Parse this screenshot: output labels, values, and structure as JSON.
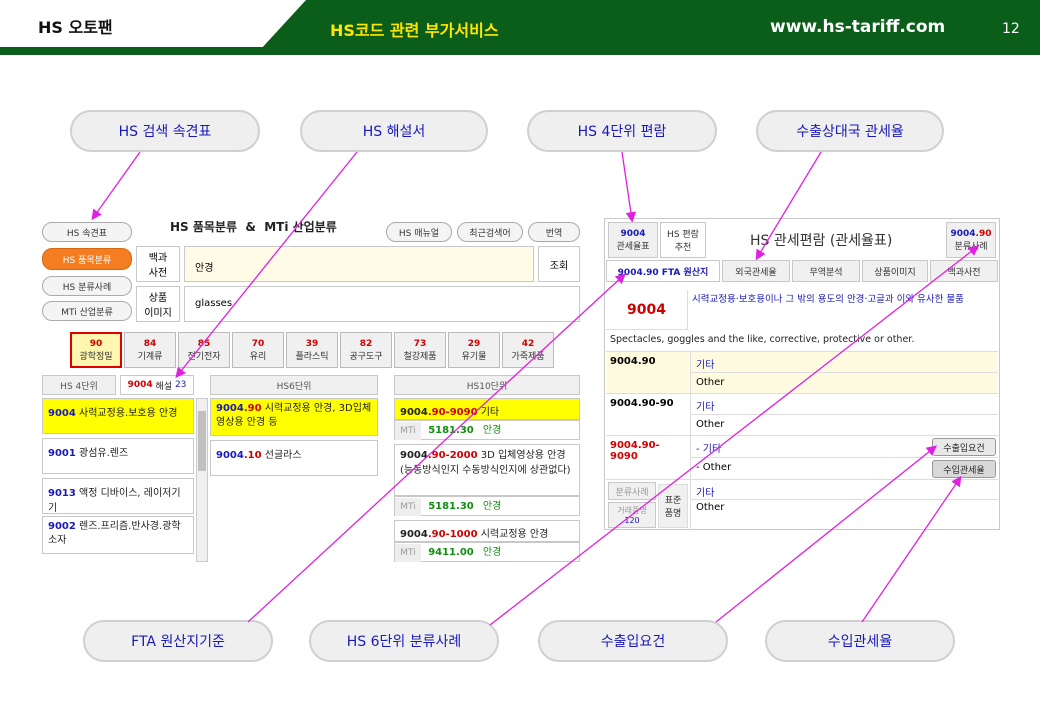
{
  "header": {
    "brand": "HS 오토팬",
    "title": "HS코드 관련 부가서비스",
    "url": "www.hs-tariff.com",
    "page": "12"
  },
  "callouts": {
    "c1": "HS 검색 속견표",
    "c2": "HS 해설서",
    "c3": "HS 4단위 편람",
    "c4": "수출상대국 관세율",
    "c5": "FTA 원산지기준",
    "c6": "HS 6단위 분류사례",
    "c7": "수출입요건",
    "c8": "수입관세율"
  },
  "left": {
    "side": [
      "HS 속견표",
      "HS 품목분류",
      "HS 분류사례",
      "MTi 산업분류"
    ],
    "title": "HS 품목분류  &  MTi 산업분류",
    "top_buttons": [
      "HS 매뉴얼",
      "최근검색어",
      "번역"
    ],
    "field1_label": "백과\n사전",
    "field1_value": "안경",
    "field2_label": "상품\n이미지",
    "field2_value": "glasses",
    "lookup": "조회",
    "cats": [
      {
        "n": "90",
        "t": "광학정밀"
      },
      {
        "n": "84",
        "t": "기계류"
      },
      {
        "n": "85",
        "t": "전기전자"
      },
      {
        "n": "70",
        "t": "유리"
      },
      {
        "n": "39",
        "t": "플라스틱"
      },
      {
        "n": "82",
        "t": "공구도구"
      },
      {
        "n": "73",
        "t": "철강제품"
      },
      {
        "n": "29",
        "t": "유기물"
      },
      {
        "n": "42",
        "t": "가죽제품"
      }
    ],
    "col_hs4": "HS 4단위",
    "col_hs4_code": "9004",
    "col_hs4_tag": "해설",
    "col_hs4_count": "23",
    "col_hs6": "HS6단위",
    "col_hs10": "HS10단위",
    "hs4_rows": [
      {
        "code": "9004",
        "text": "사력교정용.보호용 안경"
      },
      {
        "code": "9001",
        "text": "광섬유.렌즈"
      },
      {
        "code": "9013",
        "text": "액정 디바이스, 레이저기기"
      },
      {
        "code": "9002",
        "text": "렌즈.프리즘.반사경.광학소자"
      }
    ],
    "hs6_rows": [
      {
        "code": "9004",
        "suffix": ".90",
        "text": "시력교정용 안경, 3D입체 영상용 안경 등"
      },
      {
        "code": "9004",
        "suffix": ".10",
        "text": "선글라스"
      }
    ],
    "hs10_rows": [
      {
        "code": "9004",
        "suffix": ".90-9090",
        "text": "기타",
        "mti_label": "MTi",
        "mti": "5181.30",
        "mti_text": "안경"
      },
      {
        "code": "9004",
        "suffix": ".90-2000",
        "text": "3D 입체영상용 안경(능동방식인지 수동방식인지에 상관없다)",
        "mti_label": "MTi",
        "mti": "5181.30",
        "mti_text": "안경"
      },
      {
        "code": "9004",
        "suffix": ".90-1000",
        "text": "시력교정용 안경",
        "mti_label": "MTi",
        "mti": "9411.00",
        "mti_text": "안경"
      }
    ]
  },
  "right": {
    "tab1_code": "9004",
    "tab1_label": "관세율표",
    "tab2_a": "HS 편람",
    "tab2_b": "추천",
    "title": "HS 관세편람 (관세율표)",
    "tab3_code": "9004",
    "tab3_suffix": ".90",
    "tab3_label": "분류사례",
    "subtabs": [
      "9004.90 FTA 원산지",
      "외국관세율",
      "무역분석",
      "상품이미지",
      "백과사전"
    ],
    "main_code": "9004",
    "main_desc": "시력교정용·보호용이나 그 밖의 용도의 안경·고글과 이와 유사한 물품",
    "main_desc_en": "Spectacles, goggles and the like, corrective, protective or other.",
    "rows": [
      {
        "code": "9004.90",
        "ko": "기타",
        "en": "Other"
      },
      {
        "code": "9004.90-90",
        "ko": "기타",
        "en": "Other"
      },
      {
        "code": "9004.90-9090",
        "ko": "- 기타",
        "en": "- Other"
      }
    ],
    "btn_req": "수출입요건",
    "btn_tariff": "수입관세율",
    "side_a": "분류사례",
    "side_b": "거래품명",
    "side_b_num": "120",
    "std_label": "표준\n품명",
    "std_ko": "기타",
    "std_en": "Other"
  },
  "colors": {
    "green": "#0b5e19",
    "yellow": "#ffe600",
    "arrow": "#e020e0",
    "accent": "#f37d20"
  }
}
